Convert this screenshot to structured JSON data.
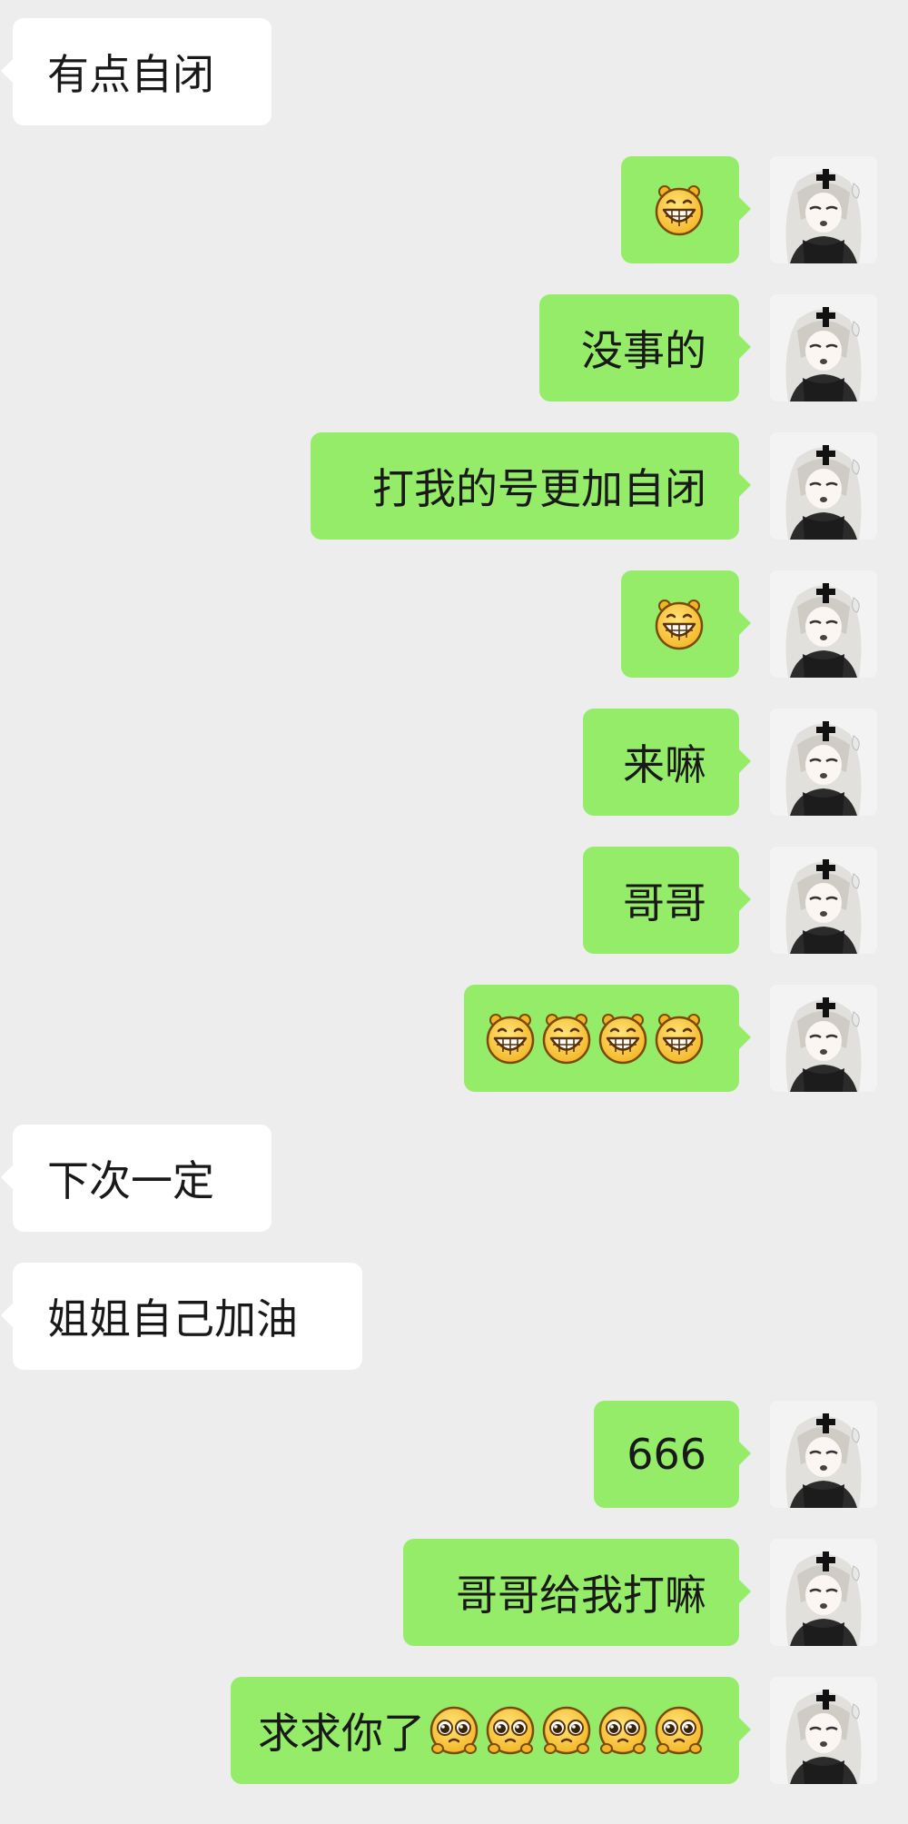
{
  "messages": [
    {
      "side": "in",
      "text": "有点自闭",
      "emojis": []
    },
    {
      "side": "out",
      "text": "",
      "emojis": [
        "grin-emoji"
      ]
    },
    {
      "side": "out",
      "text": "没事的",
      "emojis": []
    },
    {
      "side": "out",
      "text": "打我的号更加自闭",
      "emojis": []
    },
    {
      "side": "out",
      "text": "",
      "emojis": [
        "grin-emoji"
      ]
    },
    {
      "side": "out",
      "text": "来嘛",
      "emojis": []
    },
    {
      "side": "out",
      "text": "哥哥",
      "emojis": []
    },
    {
      "side": "out",
      "text": "",
      "emojis": [
        "grin-emoji",
        "grin-emoji",
        "grin-emoji",
        "grin-emoji"
      ]
    },
    {
      "side": "in",
      "text": "下次一定",
      "emojis": []
    },
    {
      "side": "in",
      "text": "姐姐自己加油",
      "emojis": []
    },
    {
      "side": "out",
      "text": "666",
      "emojis": []
    },
    {
      "side": "out",
      "text": "哥哥给我打嘛",
      "emojis": []
    },
    {
      "side": "out",
      "text": "求求你了",
      "emojis": [
        "pleading-emoji",
        "pleading-emoji",
        "pleading-emoji",
        "pleading-emoji",
        "pleading-emoji"
      ]
    }
  ],
  "colors": {
    "background": "#ededed",
    "incoming_bubble": "#ffffff",
    "outgoing_bubble": "#95ec69",
    "text": "#191919"
  },
  "avatar_icon": "user-avatar-anime-girl"
}
